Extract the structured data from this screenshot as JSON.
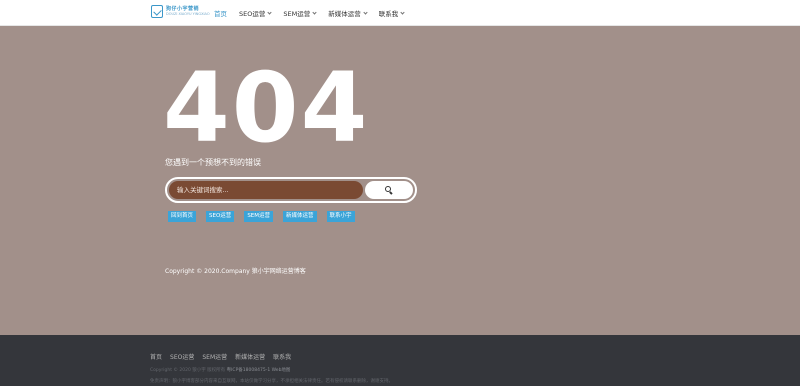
{
  "header": {
    "logo": {
      "cn": "狗仔小宇营销",
      "en": "DOUZI XIAOYU YINGXIAO"
    },
    "nav": [
      {
        "label": "首页",
        "active": true,
        "has_dropdown": false
      },
      {
        "label": "SEO运营",
        "active": false,
        "has_dropdown": true
      },
      {
        "label": "SEM运营",
        "active": false,
        "has_dropdown": true
      },
      {
        "label": "新媒体运营",
        "active": false,
        "has_dropdown": true
      },
      {
        "label": "联系我",
        "active": false,
        "has_dropdown": true
      }
    ]
  },
  "main": {
    "code": "404",
    "message": "您遇到一个预想不到的错误",
    "search": {
      "placeholder": "输入关键词搜索..."
    },
    "tags": [
      "回到首页",
      "SEO运营",
      "SEM运营",
      "新媒体运营",
      "联系小宇"
    ],
    "copyright": "Copyright © 2020.Company 狼小宇网络运营博客"
  },
  "footer": {
    "links": [
      "首页",
      "SEO运营",
      "SEM运营",
      "新媒体运营",
      "联系我"
    ],
    "line1_prefix": "Copyright © 2020 狼小宇 版权所有",
    "line1_link": "粤ICP备18008475-1 Web地图",
    "line2": "免责声明：狼小宇博客部分内容来自互联网，本站仅做学习分享，不承担相关法律责任。若有侵权请联系删除，谢谢支持。"
  },
  "colors": {
    "page_bg": "#a2908a",
    "accent": "#3b97c9",
    "search_bg": "#7a4a33",
    "tag_bg": "#3ba4d8",
    "footer_bg": "#34363b"
  }
}
